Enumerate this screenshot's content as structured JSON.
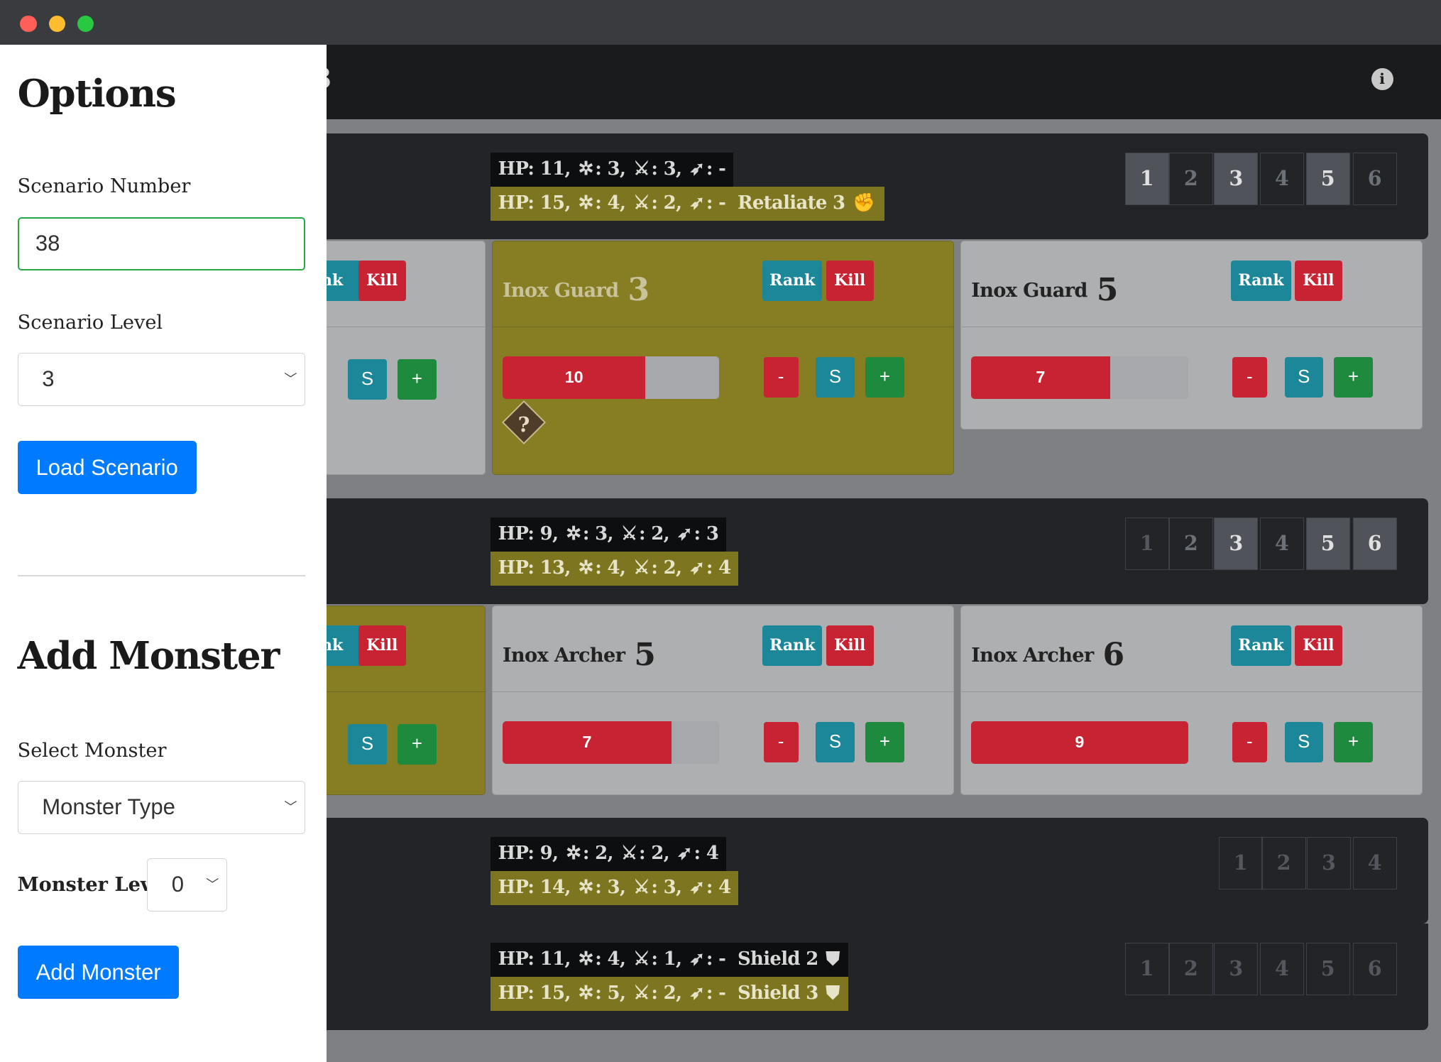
{
  "window": {
    "traffic": [
      "#fe5f57",
      "#febc2e",
      "#28c840"
    ]
  },
  "navbar": {
    "brand_partial": "3",
    "info_icon": "i"
  },
  "sidebar": {
    "options_title": "Options",
    "scenario_number_label": "Scenario Number",
    "scenario_number_value": "38",
    "scenario_level_label": "Scenario Level",
    "scenario_level_value": "3",
    "load_button": "Load Scenario",
    "add_title": "Add Monster",
    "select_monster_label": "Select Monster",
    "monster_type_value": "Monster Type",
    "monster_level_label": "Monster Level:",
    "monster_level_value": "0",
    "add_button": "Add Monster"
  },
  "groups": [
    {
      "normal": {
        "hp": "HP: 11,",
        "move": "3,",
        "attack": "3,",
        "range": "-"
      },
      "elite": {
        "hp": "HP: 15,",
        "move": "4,",
        "attack": "2,",
        "range": "-",
        "extra": "Retaliate 3"
      },
      "standees": [
        "1",
        "2",
        "3",
        "4",
        "5",
        "6"
      ]
    },
    {
      "normal": {
        "hp": "HP: 9,",
        "move": "3,",
        "attack": "2,",
        "range": "3"
      },
      "elite": {
        "hp": "HP: 13,",
        "move": "4,",
        "attack": "2,",
        "range": "4"
      },
      "standees": [
        "1",
        "2",
        "3",
        "4",
        "5",
        "6"
      ]
    },
    {
      "normal": {
        "hp": "HP: 9,",
        "move": "2,",
        "attack": "2,",
        "range": "4"
      },
      "elite": {
        "hp": "HP: 14,",
        "move": "3,",
        "attack": "3,",
        "range": "4"
      },
      "standees": [
        "1",
        "2",
        "3",
        "4"
      ]
    },
    {
      "normal": {
        "hp": "HP: 11,",
        "move": "4,",
        "attack": "1,",
        "range": "-",
        "extra": "Shield 2"
      },
      "elite": {
        "hp": "HP: 15,",
        "move": "5,",
        "attack": "2,",
        "range": "-",
        "extra": "Shield 3"
      },
      "standees": [
        "1",
        "2",
        "3",
        "4",
        "5",
        "6"
      ]
    }
  ],
  "cards": [
    {
      "name": "Inox Guard",
      "num": "3",
      "hp": "10",
      "hp_fraction": 0.66,
      "rank": "Rank",
      "kill": "Kill",
      "minus": "-",
      "s": "S",
      "plus": "+"
    },
    {
      "name": "Inox Guard",
      "num": "5",
      "hp": "7",
      "hp_fraction": 0.64,
      "rank": "Rank",
      "kill": "Kill",
      "minus": "-",
      "s": "S",
      "plus": "+"
    },
    {
      "name": "Inox Archer",
      "num": "5",
      "hp": "7",
      "hp_fraction": 0.78,
      "rank": "Rank",
      "kill": "Kill",
      "minus": "-",
      "s": "S",
      "plus": "+"
    },
    {
      "name": "Inox Archer",
      "num": "6",
      "hp": "9",
      "hp_fraction": 1.0,
      "rank": "Rank",
      "kill": "Kill",
      "minus": "-",
      "s": "S",
      "plus": "+"
    }
  ],
  "partial_cards": {
    "rank_partial": "nk",
    "kill": "Kill",
    "s": "S",
    "plus": "+"
  },
  "status_icon": "?"
}
